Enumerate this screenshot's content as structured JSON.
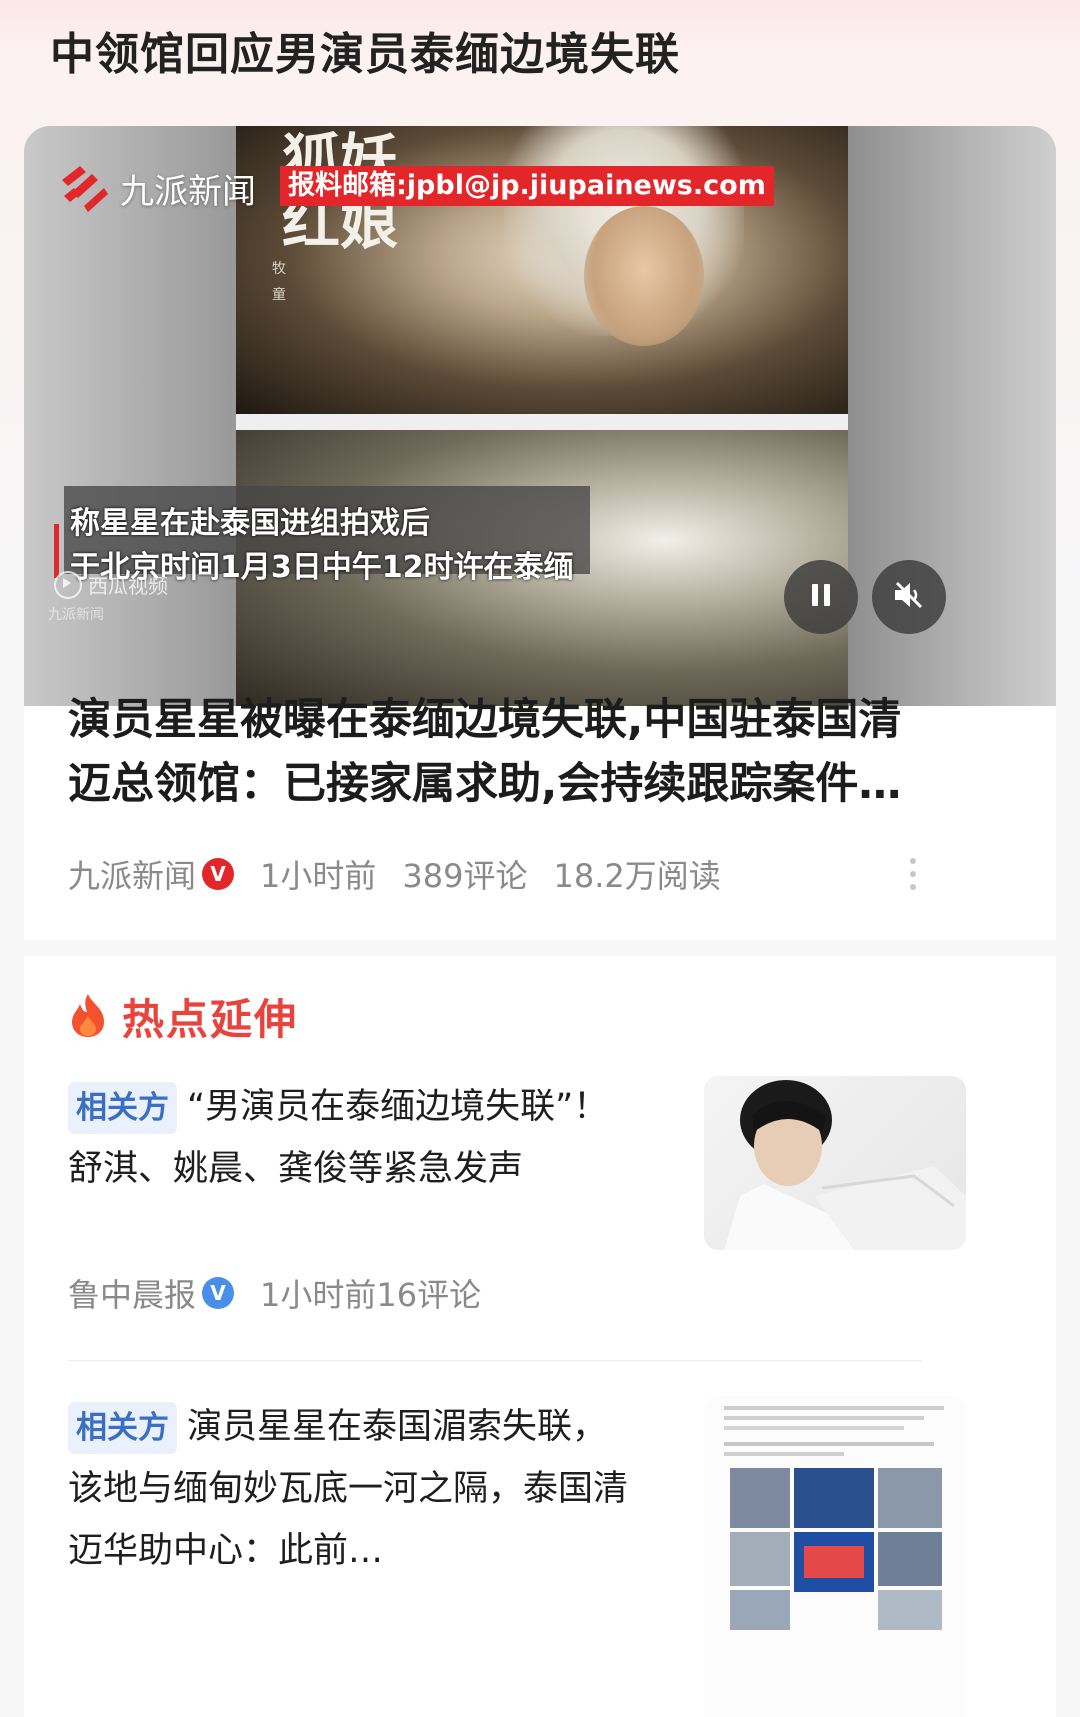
{
  "page": {
    "title": "中领馆回应男演员泰缅边境失联"
  },
  "video": {
    "logo_text": "九派新闻",
    "email_banner": "报料邮箱:jpbl@jp.jiupainews.com",
    "calligraphy_text": "狐妖红娘",
    "calligraphy_small": "牧童",
    "subtitle_line1": "称星星在赴泰国进组拍戏后",
    "subtitle_line2": "于北京时间1月3日中午12时许在泰缅",
    "source_label": "西瓜视频",
    "watermark": "九派新闻",
    "pause_icon": "pause-icon",
    "mute_icon": "muted-speaker-icon"
  },
  "article": {
    "headline": "演员星星被曝在泰缅边境失联,中国驻泰国清迈总领馆：已接家属求助,会持续跟踪案件…",
    "source": "九派新闻",
    "verified_badge": "V",
    "verified_color": "#e3262a",
    "time": "1小时前",
    "comments": "389评论",
    "reads": "18.2万阅读"
  },
  "hot": {
    "section_title": "热点延伸",
    "icon": "flame-icon",
    "accent_color": "#e8433d",
    "items": [
      {
        "tag": "相关方",
        "title": "“男演员在泰缅边境失联”！舒淇、姚晨、龚俊等紧急发声",
        "source": "鲁中晨报",
        "badge": "V",
        "badge_color": "#4a8fe7",
        "time": "1小时前",
        "comments": "16评论"
      },
      {
        "tag": "相关方",
        "title": "演员星星在泰国湄索失联，该地与缅甸妙瓦底一河之隔，泰国清迈华助中心：此前…"
      }
    ]
  }
}
